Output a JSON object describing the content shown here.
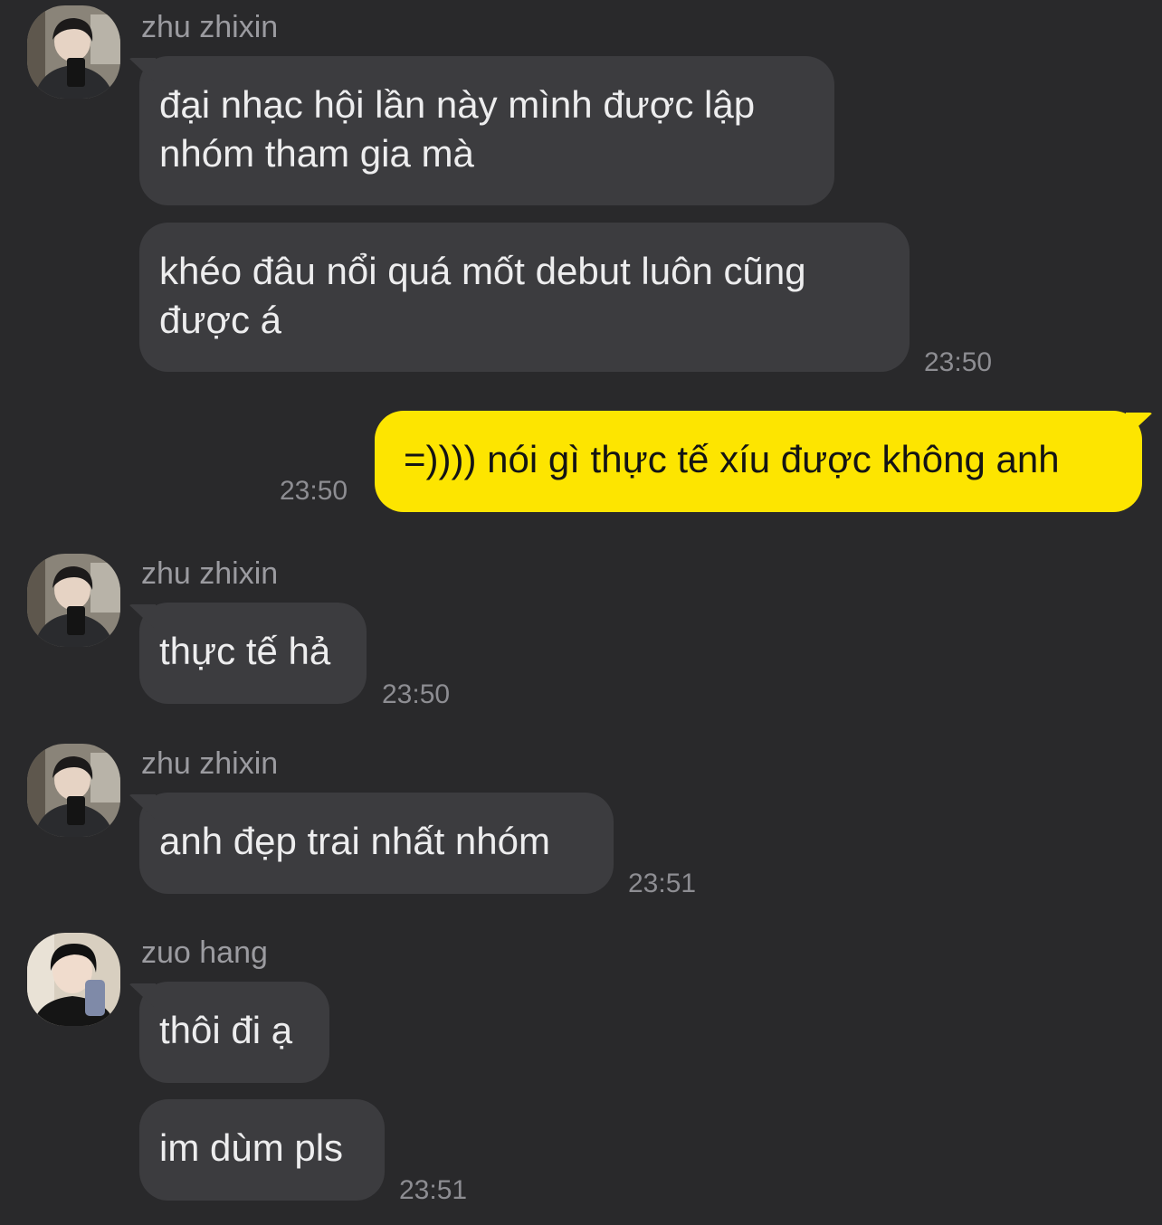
{
  "messages": [
    {
      "sender": "zhu zhixin",
      "lines": [
        [
          "đại nhạc hội lần này mình được lập",
          "nhóm tham gia mà"
        ],
        [
          "khéo đâu nổi quá mốt debut luôn cũng",
          "được á"
        ]
      ],
      "time": "23:50"
    },
    {
      "sender": "me",
      "text": "=)))) nói gì thực tế xíu được không anh",
      "time": "23:50"
    },
    {
      "sender": "zhu zhixin",
      "text": "thực tế hả",
      "time": "23:50"
    },
    {
      "sender": "zhu zhixin",
      "text": "anh đẹp trai nhất nhóm",
      "time": "23:51"
    },
    {
      "sender": "zuo hang",
      "texts": [
        "thôi đi ạ",
        "im dùm pls"
      ],
      "time": "23:51"
    }
  ],
  "colors": {
    "background": "#29292b",
    "incoming_bubble": "#3c3c3f",
    "outgoing_bubble": "#fde500",
    "sender_name": "#9b9ba0",
    "timestamp": "#8d8d92"
  }
}
